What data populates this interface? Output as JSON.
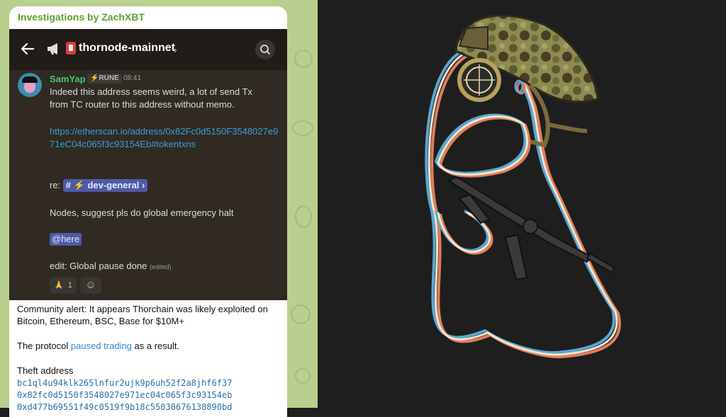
{
  "channel_title": "Investigations by ZachXBT",
  "discord": {
    "channel_name": "thornode-mainnet",
    "message": {
      "author": "SamYap",
      "tag": "RUNE",
      "time": "08:41",
      "line1": "Indeed this address seems weird, a lot of send Tx",
      "line2": "from TC router to this address without memo.",
      "link": "https://etherscan.io/address/0x82Fc0d5150F3548027e971eC04c065f3c93154Eb#tokentxns",
      "re_prefix": "re:",
      "re_channel": "dev-general",
      "nodes_text": "Nodes, suggest pls do global emergency halt",
      "mention": "@here",
      "edit_text": "edit: Global pause done",
      "edited_label": "(edited)"
    },
    "reactions": [
      {
        "emoji": "🙏",
        "count": "1"
      },
      {
        "emoji": "☺"
      }
    ]
  },
  "post": {
    "alert": "Community alert: It appears Thorchain was likely exploited on Bitcoin, Ethereum, BSC, Base for $10M+",
    "protocol_prefix": "The protocol",
    "protocol_link": "paused trading",
    "protocol_suffix": "as a result.",
    "theft_label": "Theft address",
    "addresses": [
      "bc1ql4u94klk265lnfur2ujk9p6uh52f2a8jhf6f37",
      "0x82fc0d5150f3548027e971ec04c065f3c93154eb",
      "0xd477b69551f49c0519f9b18c55030676138890bd"
    ]
  },
  "colors": {
    "telegram_bg": "#b9cf8f",
    "discord_bg": "#302a22",
    "link": "#3b9fd4",
    "author": "#4cc467",
    "illustration_bg": "#1e1e1e"
  }
}
